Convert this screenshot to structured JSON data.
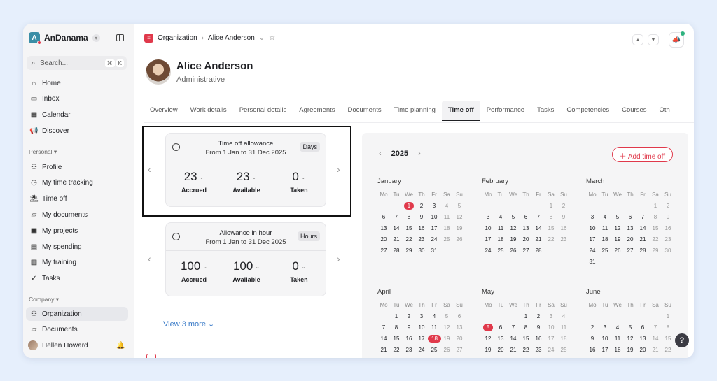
{
  "sidebar": {
    "brand": "AnDanama",
    "search_placeholder": "Search...",
    "shortcut": [
      "⌘",
      "K"
    ],
    "main_items": [
      {
        "label": "Home",
        "icon": "home-icon"
      },
      {
        "label": "Inbox",
        "icon": "inbox-icon"
      },
      {
        "label": "Calendar",
        "icon": "calendar-icon"
      },
      {
        "label": "Discover",
        "icon": "megaphone-icon"
      }
    ],
    "personal_label": "Personal",
    "personal_items": [
      {
        "label": "Profile",
        "icon": "person-icon"
      },
      {
        "label": "My time tracking",
        "icon": "clock-icon"
      },
      {
        "label": "Time off",
        "icon": "beach-icon"
      },
      {
        "label": "My documents",
        "icon": "folder-icon"
      },
      {
        "label": "My projects",
        "icon": "briefcase-icon"
      },
      {
        "label": "My spending",
        "icon": "wallet-icon"
      },
      {
        "label": "My training",
        "icon": "book-icon"
      },
      {
        "label": "Tasks",
        "icon": "check-circle-icon"
      }
    ],
    "company_label": "Company",
    "company_items": [
      {
        "label": "Organization",
        "icon": "people-icon",
        "active": true
      },
      {
        "label": "Documents",
        "icon": "folder-icon"
      }
    ],
    "user_name": "Hellen Howard"
  },
  "header": {
    "breadcrumb_root": "Organization",
    "breadcrumb_current": "Alice Anderson"
  },
  "profile": {
    "name": "Alice Anderson",
    "role": "Administrative"
  },
  "tabs": [
    "Overview",
    "Work details",
    "Personal details",
    "Agreements",
    "Documents",
    "Time planning",
    "Time off",
    "Performance",
    "Tasks",
    "Competencies",
    "Courses",
    "Oth"
  ],
  "active_tab": "Time off",
  "cards": [
    {
      "title": "Time off allowance",
      "subtitle": "From 1 Jan to 31 Dec 2025",
      "unit": "Days",
      "stats": [
        {
          "value": "23",
          "label": "Accrued"
        },
        {
          "value": "23",
          "label": "Available"
        },
        {
          "value": "0",
          "label": "Taken"
        }
      ]
    },
    {
      "title": "Allowance in hour",
      "subtitle": "From 1 Jan to 31 Dec 2025",
      "unit": "Hours",
      "stats": [
        {
          "value": "100",
          "label": "Accrued"
        },
        {
          "value": "100",
          "label": "Available"
        },
        {
          "value": "0",
          "label": "Taken"
        }
      ]
    }
  ],
  "view_more": "View 3 more",
  "calendar": {
    "year": "2025",
    "add_button": "Add time off",
    "weekdays": [
      "Mo",
      "Tu",
      "We",
      "Th",
      "Fr",
      "Sa",
      "Su"
    ],
    "months": [
      {
        "name": "January",
        "offset": 2,
        "days": 31,
        "highlight": 1
      },
      {
        "name": "February",
        "offset": 5,
        "days": 28,
        "highlight": null
      },
      {
        "name": "March",
        "offset": 5,
        "days": 31,
        "highlight": null
      },
      {
        "name": "April",
        "offset": 1,
        "days": 30,
        "highlight": 18
      },
      {
        "name": "May",
        "offset": 3,
        "days": 31,
        "highlight": 5
      },
      {
        "name": "June",
        "offset": 6,
        "days": 30,
        "highlight": null
      }
    ],
    "accent": "#e0394b"
  }
}
